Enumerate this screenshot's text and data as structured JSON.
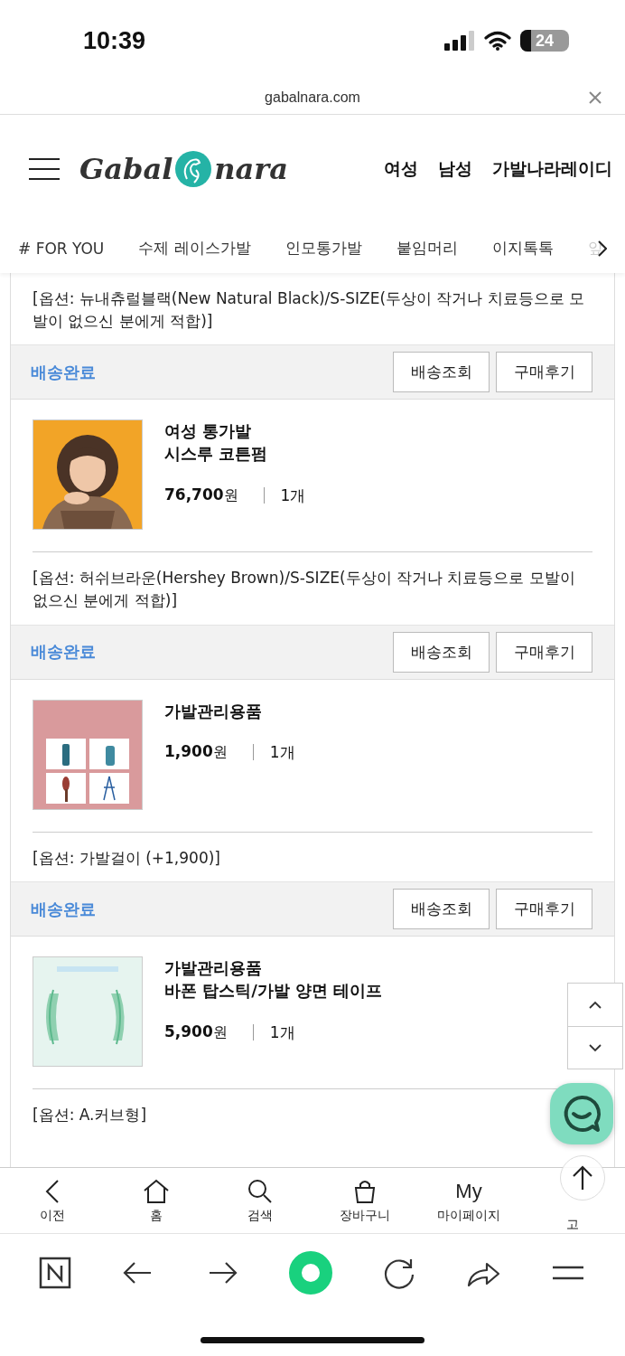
{
  "status_bar": {
    "time": "10:39",
    "battery": "24"
  },
  "browser": {
    "url": "gabalnara.com"
  },
  "header": {
    "logo": {
      "left": "Gabal",
      "right": "nara"
    },
    "nav": [
      "여성",
      "남성",
      "가발나라레이디"
    ]
  },
  "categories": [
    {
      "label": "# FOR YOU",
      "faded": false
    },
    {
      "label": "수제 레이스가발",
      "faded": false
    },
    {
      "label": "인모통가발",
      "faded": false
    },
    {
      "label": "붙임머리",
      "faded": false
    },
    {
      "label": "이지톡톡",
      "faded": false
    },
    {
      "label": "앞",
      "faded": true
    }
  ],
  "order_items": [
    {
      "kind": "option",
      "text": "[옵션: 뉴내츄럴블랙(New Natural Black)/S-SIZE(두상이 작거나 치료등으로 모발이 없으신 분에게 적합)]"
    },
    {
      "kind": "status",
      "status": "배송완료",
      "buttons": [
        "배송조회",
        "구매후기"
      ]
    },
    {
      "kind": "product",
      "name": [
        "여성 통가발",
        "시스루 코튼펌"
      ],
      "price": "76,700",
      "currency": "원",
      "qty": "1개"
    },
    {
      "kind": "option",
      "text": "[옵션: 허쉬브라운(Hershey Brown)/S-SIZE(두상이 작거나 치료등으로 모발이 없으신 분에게 적합)]"
    },
    {
      "kind": "status",
      "status": "배송완료",
      "buttons": [
        "배송조회",
        "구매후기"
      ]
    },
    {
      "kind": "product",
      "name": [
        "가발관리용품"
      ],
      "price": "1,900",
      "currency": "원",
      "qty": "1개"
    },
    {
      "kind": "option",
      "text": "[옵션: 가발걸이 (+1,900)]"
    },
    {
      "kind": "status",
      "status": "배송완료",
      "buttons": [
        "배송조회",
        "구매후기"
      ]
    },
    {
      "kind": "product",
      "name": [
        "가발관리용품",
        "바폰 탑스틱/가발 양면 테이프"
      ],
      "price": "5,900",
      "currency": "원",
      "qty": "1개"
    },
    {
      "kind": "option",
      "text": "[옵션: A.커브형]"
    }
  ],
  "site_nav": [
    {
      "kind": "back",
      "label": "이전"
    },
    {
      "kind": "home",
      "label": "홈"
    },
    {
      "kind": "search",
      "label": "검색"
    },
    {
      "kind": "bag",
      "label": "장바구니"
    },
    {
      "kind": "my",
      "icon_text": "My",
      "label": "마이페이지"
    },
    {
      "kind": "plain",
      "label": "고"
    }
  ]
}
